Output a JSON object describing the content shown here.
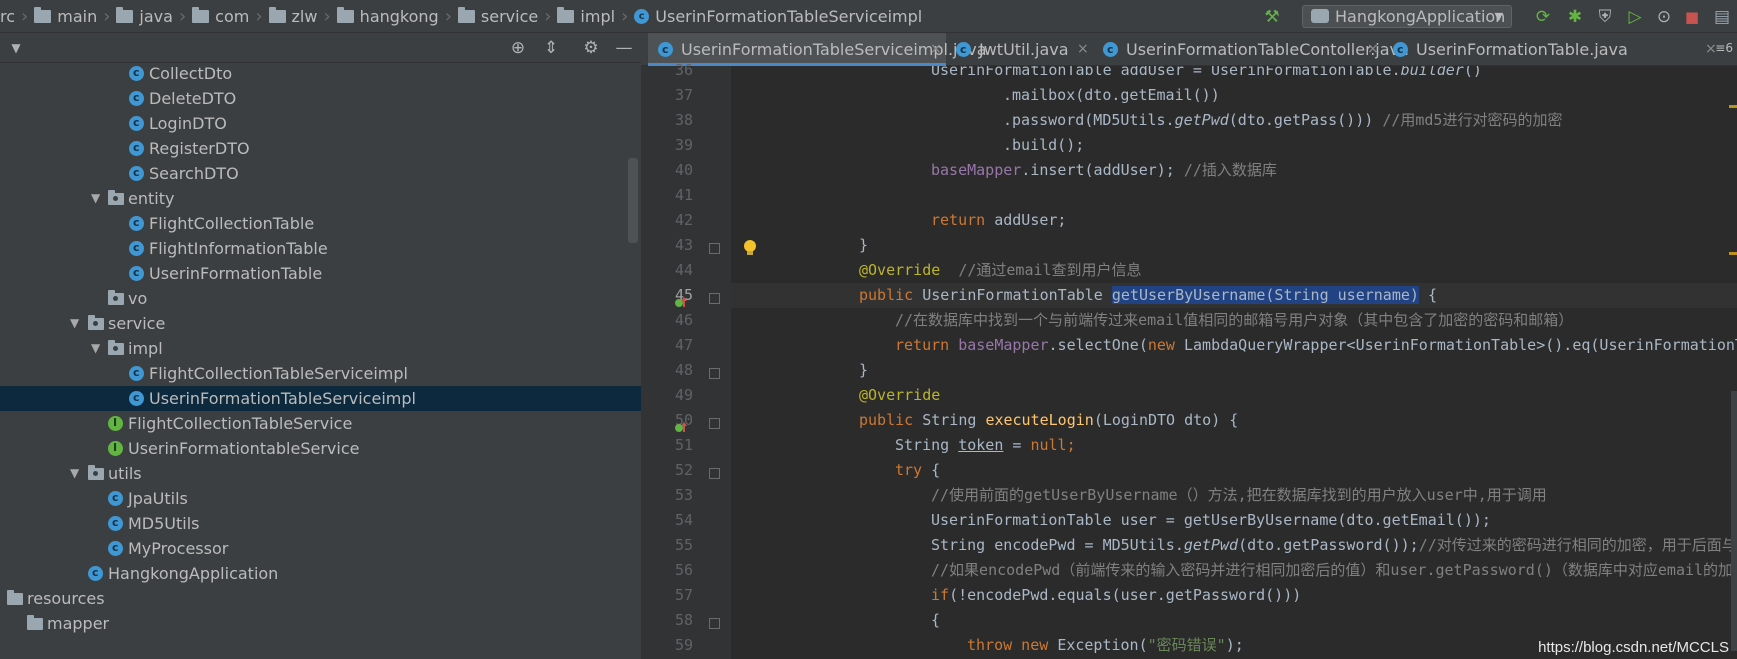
{
  "breadcrumbs": [
    {
      "label": "rc",
      "icon": "folder-icon"
    },
    {
      "label": "main",
      "icon": "folder-icon"
    },
    {
      "label": "java",
      "icon": "folder-icon"
    },
    {
      "label": "com",
      "icon": "folder-icon"
    },
    {
      "label": "zlw",
      "icon": "folder-icon"
    },
    {
      "label": "hangkong",
      "icon": "folder-icon"
    },
    {
      "label": "service",
      "icon": "folder-icon"
    },
    {
      "label": "impl",
      "icon": "folder-icon"
    },
    {
      "label": "UserinFormationTableServiceimpl",
      "icon": "class-icon"
    }
  ],
  "run_config": {
    "label": "HangkongApplication"
  },
  "project_tree": [
    {
      "label": "CollectDto",
      "kind": "class"
    },
    {
      "label": "DeleteDTO",
      "kind": "class"
    },
    {
      "label": "LoginDTO",
      "kind": "class"
    },
    {
      "label": "RegisterDTO",
      "kind": "class"
    },
    {
      "label": "SearchDTO",
      "kind": "class"
    },
    {
      "label": "entity",
      "kind": "package"
    },
    {
      "label": "FlightCollectionTable",
      "kind": "class"
    },
    {
      "label": "FlightInformationTable",
      "kind": "class"
    },
    {
      "label": "UserinFormationTable",
      "kind": "class"
    },
    {
      "label": "vo",
      "kind": "package"
    },
    {
      "label": "service",
      "kind": "package"
    },
    {
      "label": "impl",
      "kind": "package"
    },
    {
      "label": "FlightCollectionTableServiceimpl",
      "kind": "class"
    },
    {
      "label": "UserinFormationTableServiceimpl",
      "kind": "class",
      "selected": true
    },
    {
      "label": "FlightCollectionTableService",
      "kind": "interface"
    },
    {
      "label": "UserinFormationtableService",
      "kind": "interface"
    },
    {
      "label": "utils",
      "kind": "package"
    },
    {
      "label": "JpaUtils",
      "kind": "class"
    },
    {
      "label": "MD5Utils",
      "kind": "class"
    },
    {
      "label": "MyProcessor",
      "kind": "class"
    },
    {
      "label": "HangkongApplication",
      "kind": "class"
    },
    {
      "label": "resources",
      "kind": "folder"
    },
    {
      "label": "mapper",
      "kind": "folder"
    }
  ],
  "tabs": [
    {
      "label": "UserinFormationTableServiceimpl.java",
      "active": true
    },
    {
      "label": "JwtUtil.java"
    },
    {
      "label": "UserinFormationTableContoller.java"
    },
    {
      "label": "UserinFormationTable.java"
    }
  ],
  "tab_overflow": "6",
  "line_numbers": [
    "36",
    "37",
    "38",
    "39",
    "40",
    "41",
    "42",
    "43",
    "44",
    "45",
    "46",
    "47",
    "48",
    "49",
    "50",
    "51",
    "52",
    "53",
    "54",
    "55",
    "56",
    "57",
    "58",
    "59"
  ],
  "code": {
    "l36": {
      "a": "UserinFormationTable addUser = UserinFormationTable.",
      "b": "builder",
      "c": "()"
    },
    "l37": ".mailbox(dto.getEmail())",
    "l38": {
      "a": ".password(MD5Utils.",
      "b": "getPwd",
      "c": "(dto.getPass())) ",
      "d": "//用md5进行对密码的加密"
    },
    "l39": ".build();",
    "l40": {
      "a": "baseMapper",
      "b": ".insert(addUser); ",
      "c": "//插入数据库"
    },
    "l42": {
      "a": "return ",
      "b": "addUser;"
    },
    "l43": "}",
    "l44": {
      "a": "@Override",
      "b": "  //通过email查到用户信息"
    },
    "l45": {
      "a": "public ",
      "b": "UserinFormationTable ",
      "c": "getUserByUsername(String username)",
      "d": " {"
    },
    "l46": "//在数据库中找到一个与前端传过来email值相同的邮箱号用户对象（其中包含了加密的密码和邮箱）",
    "l47": {
      "a": "return ",
      "b": "baseMapper",
      "c": ".selectOne(",
      "d": "new ",
      "e": "LambdaQueryWrapper<UserinFormationTable>().eq(UserinFormationTable::getM"
    },
    "l48": "}",
    "l49": "@Override",
    "l50": {
      "a": "public ",
      "b": "String ",
      "c": "executeLogin",
      "d": "(LoginDTO dto) {"
    },
    "l51": {
      "a": "String ",
      "b": "token",
      "c": " = ",
      "d": "null",
      "e": ";"
    },
    "l52": {
      "a": "try ",
      "b": "{"
    },
    "l53": "//使用前面的getUserByUsername（）方法,把在数据库找到的用户放入user中,用于调用",
    "l54": "UserinFormationTable user = getUserByUsername(dto.getEmail());",
    "l55": {
      "a": "String encodePwd = MD5Utils.",
      "b": "getPwd",
      "c": "(dto.getPassword());",
      "d": "//对传过来的密码进行相同的加密，用于后面与数据库中的"
    },
    "l56": "//如果encodePwd（前端传来的输入密码并进行相同加密后的值）和user.getPassword()（数据库中对应email的加密密码）",
    "l57": {
      "a": "if",
      "b": "(!encodePwd.equals(user.getPassword()))"
    },
    "l58": "{",
    "l59": {
      "a": "throw new ",
      "b": "Exception(",
      "c": "\"密码错误\"",
      "d": ");"
    }
  },
  "watermark": "https://blog.csdn.net/MCCLS"
}
